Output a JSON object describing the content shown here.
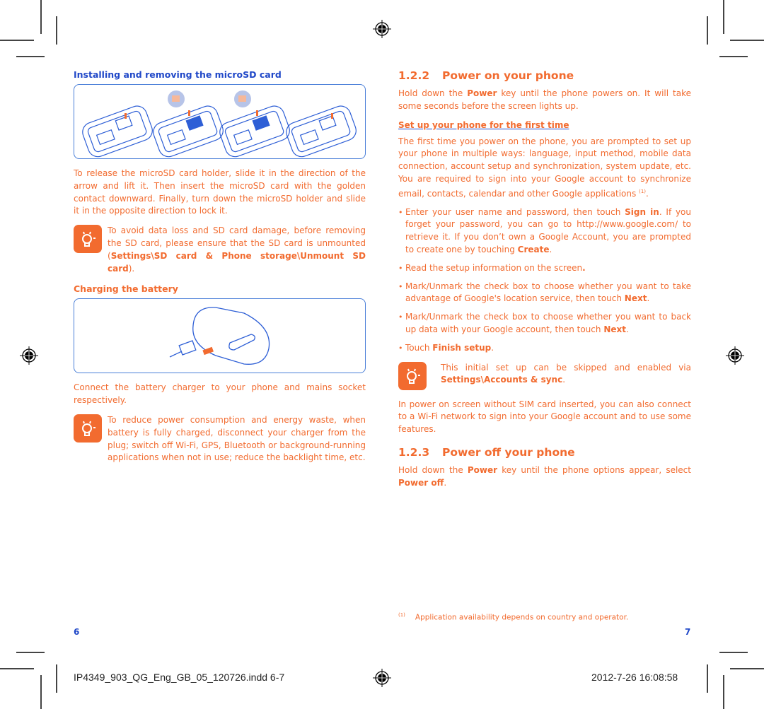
{
  "left_page": {
    "microsd_heading": "Installing and removing the microSD card",
    "microsd_body": "To release the microSD card holder, slide it in the direction of the arrow and lift it. Then insert the microSD card with the golden contact downward. Finally, turn down the microSD holder and slide it in the opposite direction to lock it.",
    "microsd_note": {
      "text_before": "To avoid data loss and SD card damage, before removing the SD card, please ensure that the SD card is unmounted (",
      "bold": "Settings\\SD card & Phone storage\\Unmount SD card",
      "text_after": ")."
    },
    "charging_heading": "Charging the battery",
    "charging_body": "Connect the battery charger to your phone and mains socket respectively.",
    "charging_note": "To reduce power consumption and energy waste, when battery is fully charged, disconnect your charger from the plug; switch off Wi-Fi, GPS, Bluetooth or background-running applications when not in use; reduce the backlight time, etc.",
    "page_number": "6"
  },
  "right_page": {
    "power_on": {
      "number": "1.2.2",
      "title": "Power on your phone",
      "body_before": "Hold down the ",
      "body_bold": "Power",
      "body_after": " key until the phone powers on. It will take some seconds before the screen lights up."
    },
    "setup_link": "Set up your phone for the first time",
    "setup_body": "The first time you power on the phone, you are prompted to set up your phone in multiple ways: language, input method, mobile data connection, account setup and synchronization, system update, etc. You are required to sign into your Google account to synchronize email, contacts, calendar and other Google applications",
    "setup_footnote_ref": "(1)",
    "bullets": [
      {
        "a": "Enter your user name and password, then touch ",
        "b": "Sign in",
        "c": ". If you forget your password, you can go to http://www.google.com/ to retrieve it. If you don’t own a Google Account, you are prompted to create one by touching ",
        "d": "Create",
        "e": "."
      },
      {
        "a": "Read the setup information on the screen",
        "b": ".",
        "c": "",
        "d": "",
        "e": ""
      },
      {
        "a": "Mark/Unmark the check box to choose whether you want to take advantage of Google's location service, then touch ",
        "b": "Next",
        "c": ".",
        "d": "",
        "e": ""
      },
      {
        "a": "Mark/Unmark the check box to choose whether you want to back up data with your Google account, then touch ",
        "b": "Next",
        "c": ".",
        "d": "",
        "e": ""
      },
      {
        "a": "Touch ",
        "b": "Finish setup",
        "c": ".",
        "d": "",
        "e": ""
      }
    ],
    "skip_note": {
      "text": "This initial set up can be skipped and enabled via ",
      "bold": "Settings\\Accounts & sync",
      "after": "."
    },
    "no_sim_body": "In power on screen without SIM card inserted, you can also connect to a  Wi-Fi network to sign into your Google account and to use some features.",
    "power_off": {
      "number": "1.2.3",
      "title": "Power off your phone",
      "body_before": "Hold down the ",
      "body_bold": "Power",
      "body_mid": " key until the phone options appear, select ",
      "body_bold2": "Power off",
      "body_after": "."
    },
    "footnote_marker": "(1)",
    "footnote_text": "Application availability depends on country and operator.",
    "page_number": "7"
  },
  "slug": {
    "filename": "IP4349_903_QG_Eng_GB_05_120726.indd   6-7",
    "timestamp": "2012-7-26   16:08:58"
  },
  "colors": {
    "body_text": "#f26b2f",
    "heading_blue": "#2048c8",
    "frame_blue": "#4a7fd8"
  }
}
